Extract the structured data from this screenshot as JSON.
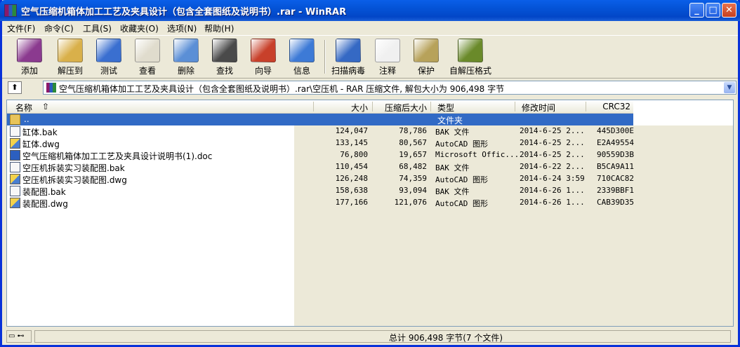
{
  "window": {
    "title": "空气压缩机箱体加工工艺及夹具设计（包含全套图纸及说明书）.rar - WinRAR",
    "minimize": "_",
    "maximize": "□",
    "close": "✕"
  },
  "menu": [
    {
      "label": "文件(F)"
    },
    {
      "label": "命令(C)"
    },
    {
      "label": "工具(S)"
    },
    {
      "label": "收藏夹(O)"
    },
    {
      "label": "选项(N)"
    },
    {
      "label": "帮助(H)"
    }
  ],
  "toolbar": [
    {
      "label": "添加",
      "icon": "add-icon",
      "color": "#8b3a8f"
    },
    {
      "label": "解压到",
      "icon": "extract-to-icon",
      "color": "#d9b04a"
    },
    {
      "label": "测试",
      "icon": "test-icon",
      "color": "#3a6fd0"
    },
    {
      "label": "查看",
      "icon": "view-icon",
      "color": "#e0dccd"
    },
    {
      "label": "删除",
      "icon": "delete-icon",
      "color": "#5b8fd6"
    },
    {
      "label": "查找",
      "icon": "find-icon",
      "color": "#4a4a4a"
    },
    {
      "label": "向导",
      "icon": "wizard-icon",
      "color": "#c8402a"
    },
    {
      "label": "信息",
      "icon": "info-icon",
      "color": "#3d7ad6"
    },
    {
      "label": "扫描病毒",
      "icon": "virus-scan-icon",
      "color": "#3569c4"
    },
    {
      "label": "注释",
      "icon": "comment-icon",
      "color": "#f0f0f0"
    },
    {
      "label": "保护",
      "icon": "protect-icon",
      "color": "#b7a25a"
    },
    {
      "label": "自解压格式",
      "icon": "sfx-icon",
      "color": "#6a8a2a"
    }
  ],
  "address": {
    "up_label": "⬆",
    "path": "空气压缩机箱体加工工艺及夹具设计（包含全套图纸及说明书）.rar\\空压机 - RAR 压缩文件, 解包大小为 906,498 字节",
    "dropdown": "▼"
  },
  "columns": {
    "name": "名称",
    "sort_arrow": "⇧",
    "size": "大小",
    "packed": "压缩后大小",
    "type": "类型",
    "modified": "修改时间",
    "crc": "CRC32"
  },
  "parent_row": {
    "name": "..",
    "type": "文件夹"
  },
  "files": [
    {
      "name": "缸体.bak",
      "size": "124,047",
      "packed": "78,786",
      "type": "BAK 文件",
      "modified": "2014-6-25 2...",
      "crc": "445D300E",
      "kind": "bak"
    },
    {
      "name": "缸体.dwg",
      "size": "133,145",
      "packed": "80,567",
      "type": "AutoCAD 图形",
      "modified": "2014-6-25 2...",
      "crc": "E2A49554",
      "kind": "dwg"
    },
    {
      "name": "空气压缩机箱体加工工艺及夹具设计说明书(1).doc",
      "size": "76,800",
      "packed": "19,657",
      "type": "Microsoft Offic...",
      "modified": "2014-6-25 2...",
      "crc": "90559D3B",
      "kind": "doc"
    },
    {
      "name": "空压机拆装实习装配图.bak",
      "size": "110,454",
      "packed": "68,482",
      "type": "BAK 文件",
      "modified": "2014-6-22 2...",
      "crc": "B5CA9A11",
      "kind": "bak"
    },
    {
      "name": "空压机拆装实习装配图.dwg",
      "size": "126,248",
      "packed": "74,359",
      "type": "AutoCAD 图形",
      "modified": "2014-6-24 3:59",
      "crc": "710CAC82",
      "kind": "dwg"
    },
    {
      "name": "装配图.bak",
      "size": "158,638",
      "packed": "93,094",
      "type": "BAK 文件",
      "modified": "2014-6-26 1...",
      "crc": "2339BBF1",
      "kind": "bak"
    },
    {
      "name": "装配图.dwg",
      "size": "177,166",
      "packed": "121,076",
      "type": "AutoCAD 图形",
      "modified": "2014-6-26 1...",
      "crc": "CAB39D35",
      "kind": "dwg"
    }
  ],
  "status": {
    "left": "▭ ⊷",
    "summary": "总计 906,498 字节(7 个文件)"
  }
}
